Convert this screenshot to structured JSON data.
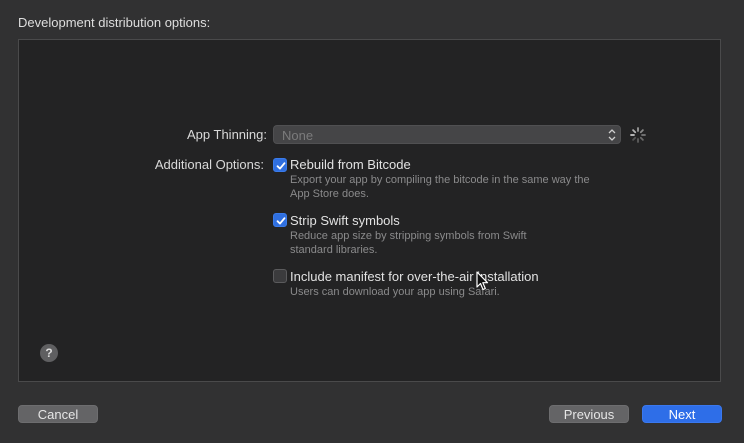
{
  "header": {
    "title": "Development distribution options:"
  },
  "form": {
    "app_thinning_label": "App Thinning:",
    "app_thinning_value": "None",
    "additional_options_label": "Additional Options:",
    "options": [
      {
        "label": "Rebuild from Bitcode",
        "checked": true,
        "desc_line1": "Export your app by compiling the bitcode in the same way the",
        "desc_line2": "App Store does."
      },
      {
        "label": "Strip Swift symbols",
        "checked": true,
        "desc_line1": "Reduce app size by stripping symbols from Swift",
        "desc_line2": "standard libraries."
      },
      {
        "label": "Include manifest for over-the-air installation",
        "checked": false,
        "desc_line1": "Users can download your app using Safari."
      }
    ],
    "help_label": "?"
  },
  "footer": {
    "cancel_label": "Cancel",
    "previous_label": "Previous",
    "next_label": "Next"
  },
  "colors": {
    "accent": "#2e6ee8"
  }
}
